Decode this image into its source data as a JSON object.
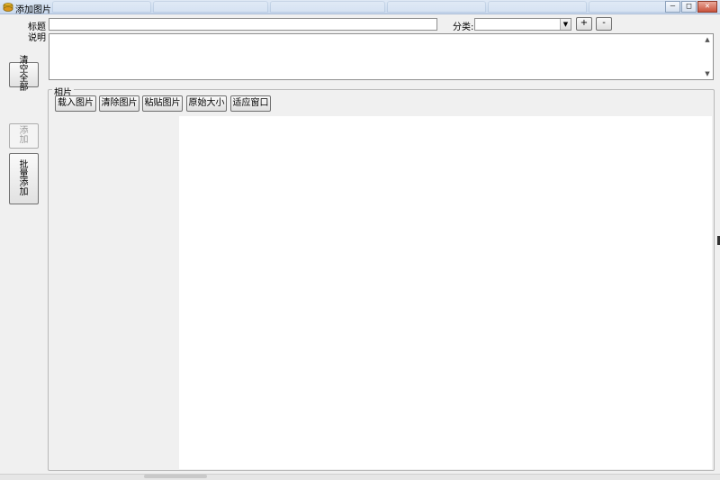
{
  "window": {
    "title": "添加图片",
    "background_tabs": [
      "",
      "",
      "",
      "",
      "",
      "",
      ""
    ],
    "controls": {
      "minimize": "–",
      "maximize": "□",
      "close": "✕"
    }
  },
  "form": {
    "title_label": "标题",
    "title_value": "",
    "description_label": "说明",
    "description_value": "",
    "category_label": "分类:",
    "category_value": "",
    "add_category_label": "+",
    "remove_category_label": "-"
  },
  "side_buttons": {
    "clear_all": "清空全部",
    "add": "添加",
    "batch_add": "批量添加"
  },
  "photo_group": {
    "legend": "相片",
    "toolbar": {
      "load_image": "载入图片",
      "clear_image": "清除图片",
      "paste_image": "粘贴图片",
      "original_size": "原始大小",
      "fit_window": "适应窗口"
    }
  },
  "colors": {
    "window_bg": "#f0f0f0",
    "canvas_bg": "#ffffff",
    "titlebar": "#c9d9ee"
  }
}
